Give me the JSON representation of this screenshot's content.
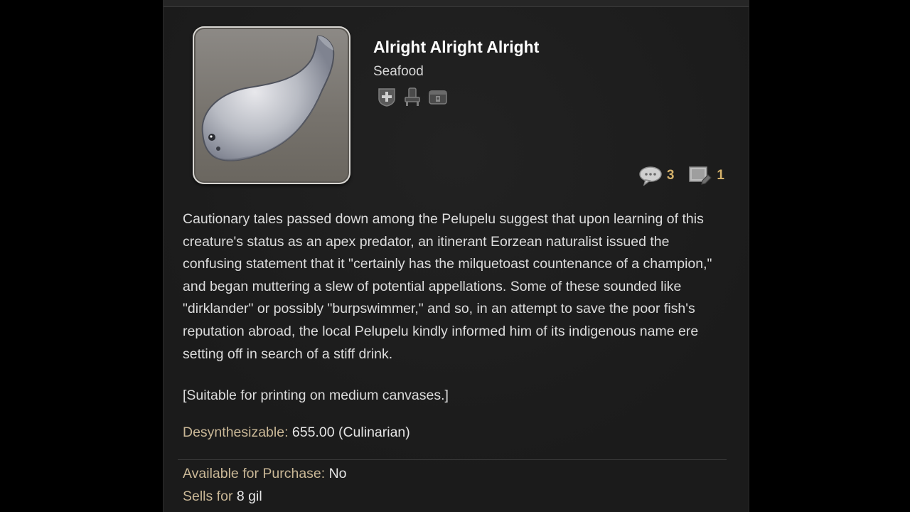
{
  "item": {
    "name": "Alright Alright Alright",
    "category": "Seafood",
    "icon": "fish-icon",
    "role_icons": [
      "shield-plus-icon",
      "chair-icon",
      "housing-icon"
    ]
  },
  "stats": {
    "comments_icon": "speech-bubble-icon",
    "comments": "3",
    "images_icon": "image-edit-icon",
    "images": "1"
  },
  "description": "Cautionary tales passed down among the Pelupelu suggest that upon learning of this creature's status as an apex predator, an itinerant Eorzean naturalist issued the confusing statement that it \"certainly has the milquetoast countenance of a champion,\" and began muttering a slew of potential appellations. Some of these sounded like \"dirklander\" or possibly \"burpswimmer,\" and so, in an attempt to save the poor fish's reputation abroad, the local Pelupelu kindly informed him of its indigenous name ere setting off in search of a stiff drink.",
  "note": "[Suitable for printing on medium canvases.]",
  "desynth": {
    "label": "Desynthesizable:",
    "value": "655.00 (Culinarian)"
  },
  "purchase": {
    "label": "Available for Purchase:",
    "value": "No"
  },
  "sells": {
    "label": "Sells for",
    "value": "8 gil"
  },
  "colors": {
    "background": "#1d1d1d",
    "label": "#c9b796",
    "stat_number": "#d4b16a",
    "text": "#dcdcdc"
  }
}
